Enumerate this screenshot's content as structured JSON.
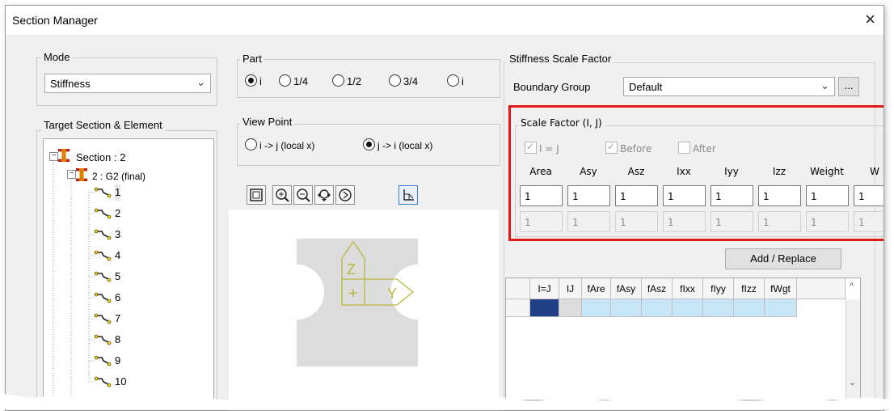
{
  "window": {
    "title": "Section Manager",
    "close_glyph": "×"
  },
  "mode": {
    "label": "Mode",
    "value": "Stiffness"
  },
  "target": {
    "label": "Target Section & Element",
    "section_node": "Section : 2",
    "group_node": "2 : G2 (final)",
    "elements": [
      "1",
      "2",
      "3",
      "4",
      "5",
      "6",
      "7",
      "8",
      "9",
      "10"
    ]
  },
  "part": {
    "label": "Part",
    "options": [
      "i",
      "1/4",
      "1/2",
      "3/4",
      "i"
    ],
    "selected_index": 0
  },
  "view_point": {
    "label": "View Point",
    "options": [
      "i -> j (local x)",
      "j -> i (local x)"
    ],
    "selected_index": 1
  },
  "toolbar": {
    "icons": [
      "zoom-fit-icon",
      "zoom-in-icon",
      "zoom-out-icon",
      "pan-icon",
      "rotate-icon",
      "section-view-icon"
    ]
  },
  "preview": {
    "z_label": "Z",
    "y_label": "Y",
    "origin_glyph": "+",
    "axis_color": "#b8b83a",
    "section_color": "#dcdcdc"
  },
  "stiffness": {
    "label": "Stiffness Scale Factor",
    "boundary_group_label": "Boundary Group",
    "boundary_group_value": "Default",
    "browse_label": "...",
    "scale_factor": {
      "label": "Scale Factor (I, J)",
      "i_eq_j": "I = J",
      "before": "Before",
      "after": "After",
      "columns": [
        "Area",
        "Asy",
        "Asz",
        "Ixx",
        "Iyy",
        "Izz",
        "Weight",
        "W"
      ],
      "row_i": [
        "1",
        "1",
        "1",
        "1",
        "1",
        "1",
        "1",
        "1"
      ],
      "row_j": [
        "1",
        "1",
        "1",
        "1",
        "1",
        "1",
        "1",
        "1"
      ]
    },
    "add_replace": "Add / Replace",
    "table_headers": [
      "",
      "I=J",
      "IJ",
      "fAre",
      "fAsy",
      "fAsz",
      "fIxx",
      "fIyy",
      "fIzz",
      "fWgt",
      ""
    ],
    "highlight_color": "#e01818"
  }
}
